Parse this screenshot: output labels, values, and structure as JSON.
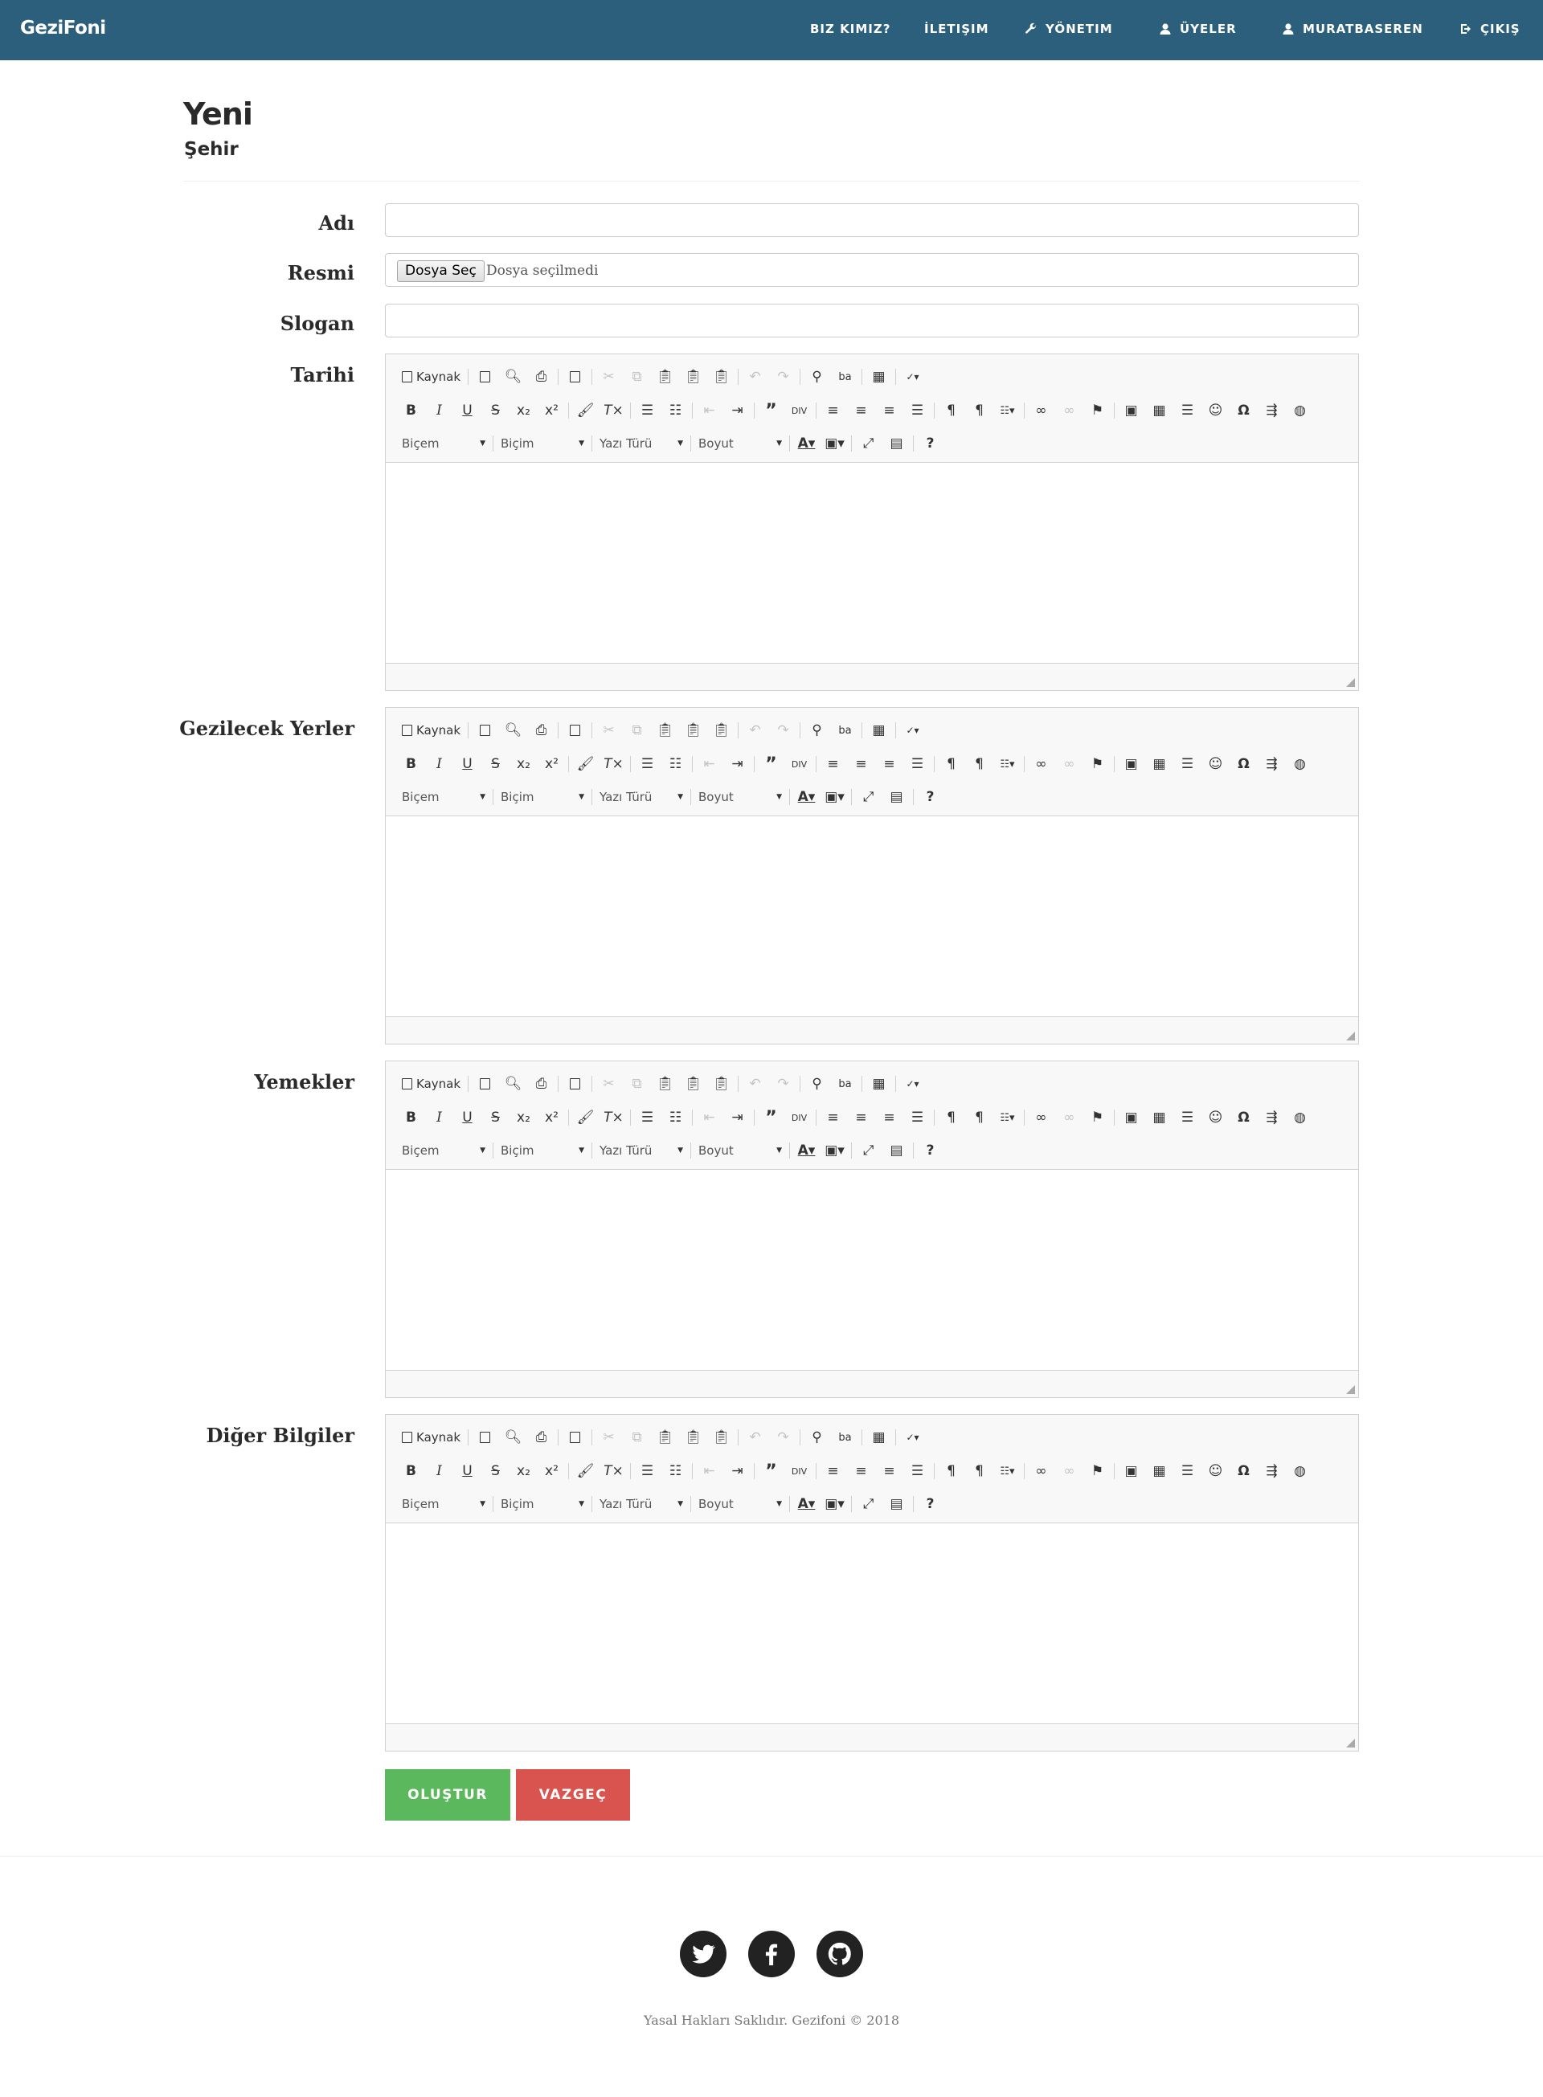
{
  "navbar": {
    "brand": "GeziFoni",
    "items": [
      {
        "label": "BIZ KIMIZ?",
        "icon": ""
      },
      {
        "label": "İLETIŞIM",
        "icon": ""
      },
      {
        "label": "YÖNETIM",
        "icon": "wrench-icon"
      },
      {
        "label": "ÜYELER",
        "icon": "user-icon"
      },
      {
        "label": "MURATBASEREN",
        "icon": "user-icon"
      },
      {
        "label": "ÇIKIŞ",
        "icon": "logout-icon"
      }
    ],
    "background": "#2c5f7c"
  },
  "header": {
    "title": "Yeni",
    "subtitle": "Şehir"
  },
  "form": {
    "name_label": "Adı",
    "name_value": "",
    "image_label": "Resmi",
    "file_button": "Dosya Seç",
    "file_status": "Dosya seçilmedi",
    "slogan_label": "Slogan",
    "slogan_value": "",
    "editors": [
      {
        "label": "Tarihi"
      },
      {
        "label": "Gezilecek Yerler"
      },
      {
        "label": "Yemekler"
      },
      {
        "label": "Diğer Bilgiler"
      }
    ],
    "toolbar": {
      "source": "Kaynak",
      "style": "Biçem",
      "format": "Biçim",
      "font": "Yazı Türü",
      "size": "Boyut"
    },
    "create_button": "OLUŞTUR",
    "cancel_button": "VAZGEÇ"
  },
  "colors": {
    "create": "#5cb85c",
    "cancel": "#d9534f"
  },
  "footer": {
    "social": [
      "twitter-icon",
      "facebook-icon",
      "github-icon"
    ],
    "copyright": "Yasal Hakları Saklıdır. Gezifoni © 2018"
  }
}
